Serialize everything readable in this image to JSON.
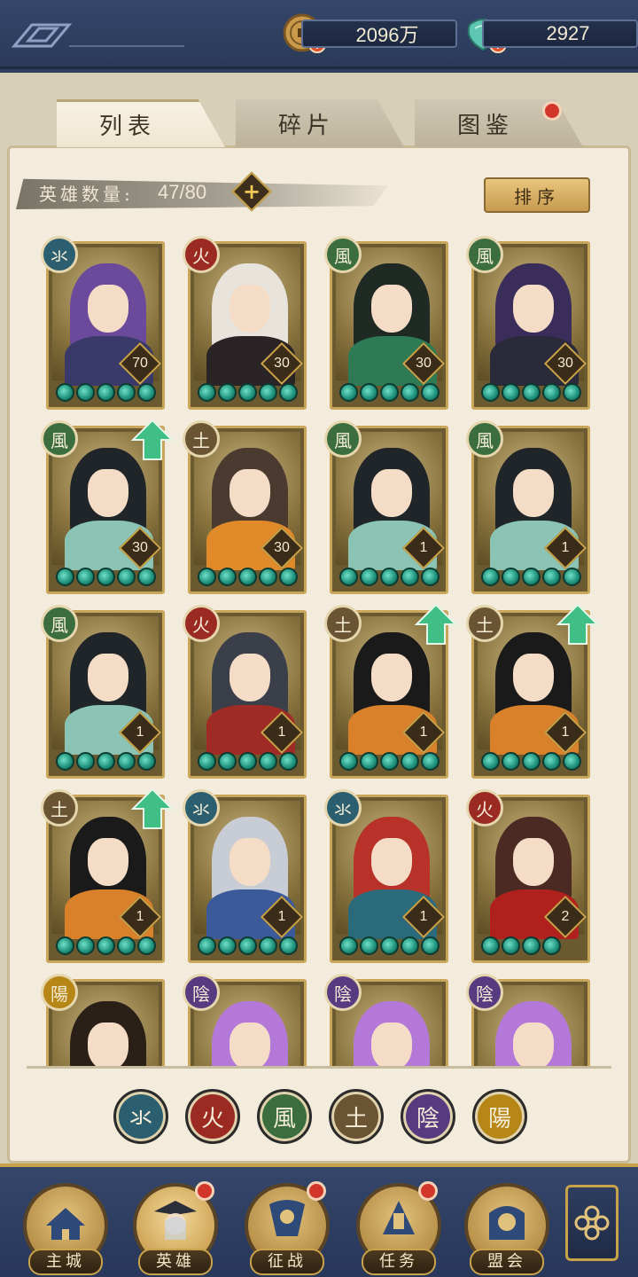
{
  "topbar": {
    "coins": "2096万",
    "jade": "2927"
  },
  "tabs": [
    {
      "label": "列表",
      "active": true
    },
    {
      "label": "碎片",
      "active": false
    },
    {
      "label": "图鉴",
      "active": false,
      "badge": true
    }
  ],
  "hero_count": {
    "label": "英雄数量:",
    "value": "47/80"
  },
  "sort_label": "排序",
  "elements": {
    "water": "氺",
    "fire": "火",
    "wind": "風",
    "earth": "土",
    "yin": "陰",
    "yang": "陽"
  },
  "colors": {
    "water": "#2b5f70",
    "fire": "#9a2a22",
    "wind": "#3b6d3e",
    "earth": "#6a5434",
    "yin": "#573a80",
    "yang": "#b68616",
    "star": "#1d8f7a",
    "gold": "#c9a24a"
  },
  "heroes": [
    {
      "element": "water",
      "level": "70",
      "stars": 5,
      "upgrade": false,
      "hair": "#6b4a9c",
      "outfit": "#3a3a6a"
    },
    {
      "element": "fire",
      "level": "30",
      "stars": 5,
      "upgrade": false,
      "hair": "#e8e4dc",
      "outfit": "#2a2426"
    },
    {
      "element": "wind",
      "level": "30",
      "stars": 5,
      "upgrade": false,
      "hair": "#1f2a25",
      "outfit": "#2d7a55"
    },
    {
      "element": "wind",
      "level": "30",
      "stars": 5,
      "upgrade": false,
      "hair": "#3a2d5a",
      "outfit": "#2a2a3a"
    },
    {
      "element": "wind",
      "level": "30",
      "stars": 5,
      "upgrade": true,
      "hair": "#1f2528",
      "outfit": "#8bc4b4"
    },
    {
      "element": "earth",
      "level": "30",
      "stars": 5,
      "upgrade": false,
      "hair": "#4a3a30",
      "outfit": "#e08a2a"
    },
    {
      "element": "wind",
      "level": "1",
      "stars": 5,
      "upgrade": false,
      "hair": "#1f2528",
      "outfit": "#8bc4b4"
    },
    {
      "element": "wind",
      "level": "1",
      "stars": 5,
      "upgrade": false,
      "hair": "#1f2528",
      "outfit": "#8bc4b4"
    },
    {
      "element": "wind",
      "level": "1",
      "stars": 5,
      "upgrade": false,
      "hair": "#1f2528",
      "outfit": "#8bc4b4"
    },
    {
      "element": "fire",
      "level": "1",
      "stars": 5,
      "upgrade": false,
      "hair": "#3a3f4a",
      "outfit": "#a02a24"
    },
    {
      "element": "earth",
      "level": "1",
      "stars": 5,
      "upgrade": true,
      "hair": "#1a1a1a",
      "outfit": "#d8802a"
    },
    {
      "element": "earth",
      "level": "1",
      "stars": 5,
      "upgrade": true,
      "hair": "#1a1a1a",
      "outfit": "#d8802a"
    },
    {
      "element": "earth",
      "level": "1",
      "stars": 5,
      "upgrade": true,
      "hair": "#1a1a1a",
      "outfit": "#d8802a"
    },
    {
      "element": "water",
      "level": "1",
      "stars": 5,
      "upgrade": false,
      "hair": "#c8ccd4",
      "outfit": "#3a5a9a"
    },
    {
      "element": "water",
      "level": "1",
      "stars": 5,
      "upgrade": false,
      "hair": "#b8322a",
      "outfit": "#2a6a7a"
    },
    {
      "element": "fire",
      "level": "2",
      "stars": 4,
      "upgrade": false,
      "hair": "#4a2a22",
      "outfit": "#b0201c"
    },
    {
      "element": "yang",
      "level": "",
      "stars": 0,
      "upgrade": false,
      "hair": "#2a2018",
      "outfit": "#5a4a30"
    },
    {
      "element": "yin",
      "level": "",
      "stars": 0,
      "upgrade": false,
      "hair": "#b478d8",
      "outfit": "#2e2a4a"
    },
    {
      "element": "yin",
      "level": "",
      "stars": 0,
      "upgrade": false,
      "hair": "#b478d8",
      "outfit": "#2e2a4a"
    },
    {
      "element": "yin",
      "level": "",
      "stars": 0,
      "upgrade": false,
      "hair": "#b478d8",
      "outfit": "#2e2a4a"
    }
  ],
  "filters": [
    "water",
    "fire",
    "wind",
    "earth",
    "yin",
    "yang"
  ],
  "nav": [
    {
      "label": "主城",
      "icon": "city-icon",
      "active": false,
      "badge": false
    },
    {
      "label": "英雄",
      "icon": "hero-icon",
      "active": true,
      "badge": true
    },
    {
      "label": "征战",
      "icon": "campaign-icon",
      "active": false,
      "badge": true
    },
    {
      "label": "任务",
      "icon": "quest-icon",
      "active": false,
      "badge": true
    },
    {
      "label": "盟会",
      "icon": "guild-icon",
      "active": false,
      "badge": false
    }
  ]
}
